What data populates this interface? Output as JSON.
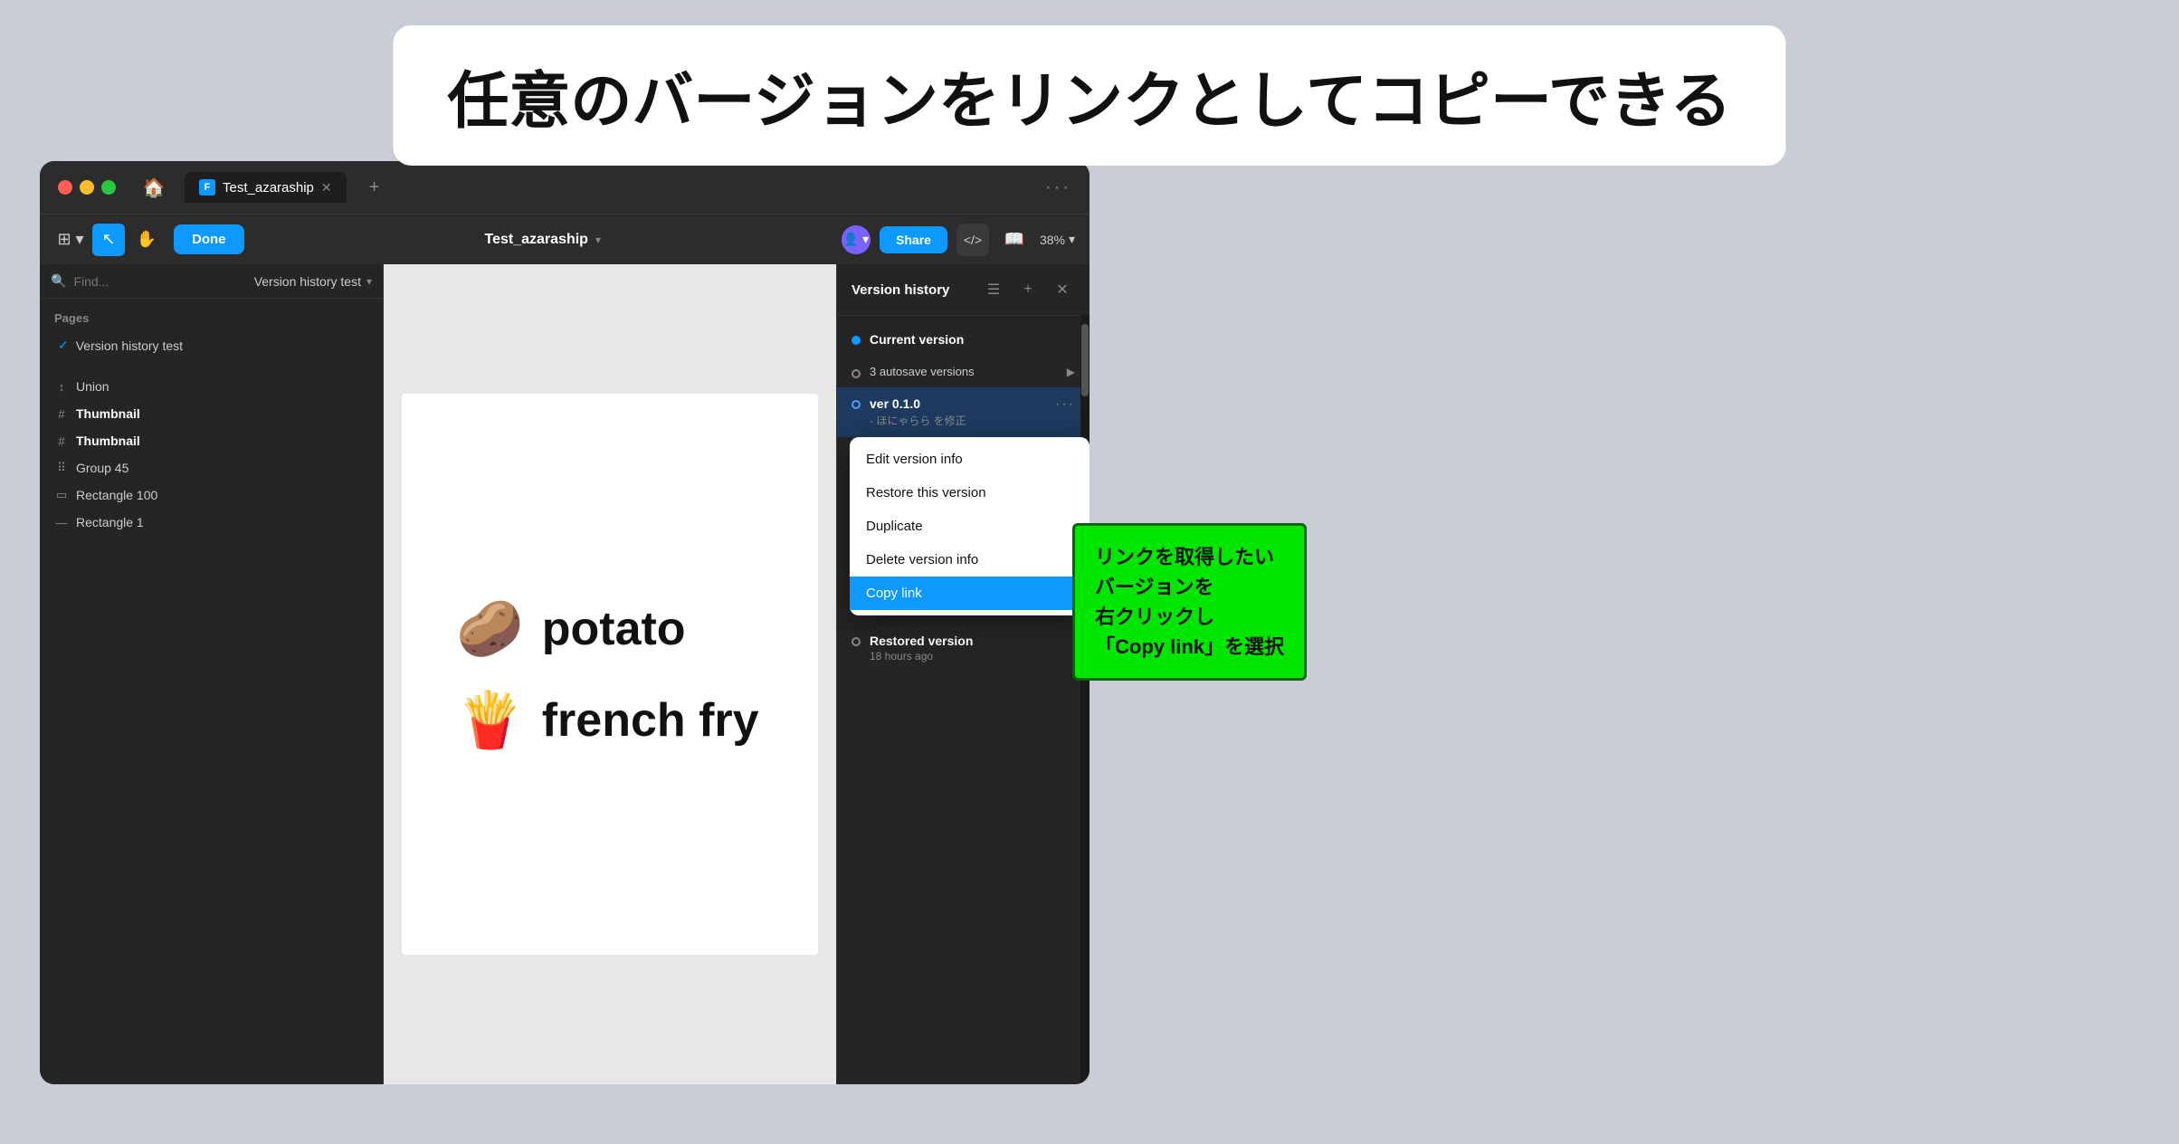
{
  "title_banner": {
    "text": "任意のバージョンをリンクとしてコピーできる"
  },
  "window": {
    "tab_name": "Test_azaraship",
    "project_name": "Test_azaraship",
    "zoom_level": "38%",
    "done_label": "Done",
    "share_label": "Share",
    "toolbar": {
      "code_btn_label": "</>",
      "book_icon": "📖"
    }
  },
  "sidebar": {
    "search_placeholder": "Find...",
    "breadcrumb": "Version history test",
    "pages_label": "Pages",
    "pages": [
      {
        "name": "Version history test",
        "active": true
      }
    ],
    "layers": [
      {
        "icon": "↕",
        "name": "Union",
        "bold": false
      },
      {
        "icon": "#",
        "name": "Thumbnail",
        "bold": true
      },
      {
        "icon": "#",
        "name": "Thumbnail",
        "bold": true
      },
      {
        "icon": "⠿",
        "name": "Group 45",
        "bold": false
      },
      {
        "icon": "▭",
        "name": "Rectangle 100",
        "bold": false
      },
      {
        "icon": "—",
        "name": "Rectangle 1",
        "bold": false
      }
    ]
  },
  "canvas": {
    "items": [
      {
        "emoji": "🥔",
        "text": "potato"
      },
      {
        "emoji": "🍟",
        "text": "french fry"
      }
    ]
  },
  "version_history": {
    "title": "Version history",
    "versions": [
      {
        "name": "Current version",
        "sub": "",
        "type": "current"
      },
      {
        "name": "3 autosave versions",
        "sub": "",
        "type": "autosave"
      },
      {
        "name": "ver 0.1.0",
        "sub": "- ほにゃらら を修正",
        "type": "selected",
        "more": "···"
      },
      {
        "name": "Restored version",
        "sub": "18 hours ago",
        "type": "normal"
      }
    ]
  },
  "context_menu": {
    "items": [
      {
        "label": "Edit version info",
        "highlighted": false
      },
      {
        "label": "Restore this version",
        "highlighted": false
      },
      {
        "label": "Duplicate",
        "highlighted": false
      },
      {
        "label": "Delete version info",
        "highlighted": false
      },
      {
        "label": "Copy link",
        "highlighted": true
      }
    ]
  },
  "callout": {
    "line1": "リンクを取得したい",
    "line2": "バージョンを",
    "line3": "右クリックし",
    "line4": "「Copy link」を選択"
  }
}
